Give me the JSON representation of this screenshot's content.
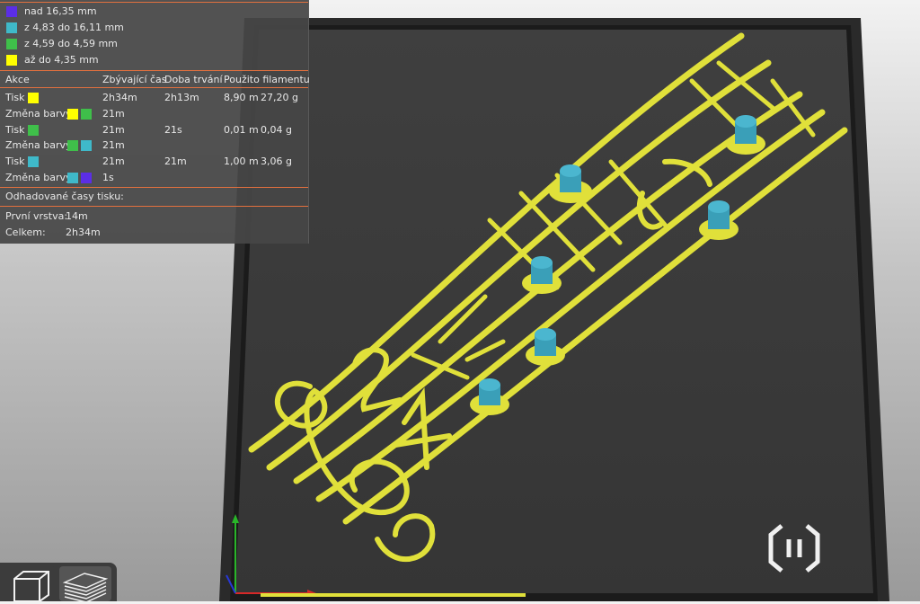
{
  "legend": {
    "ranges": [
      {
        "label": "nad 16,35 mm",
        "color": "#5b2ee6"
      },
      {
        "label": "z 4,83 do 16,11 mm",
        "color": "#3fb9c9"
      },
      {
        "label": "z 4,59 do 4,59 mm",
        "color": "#3fbf4a"
      },
      {
        "label": "až do 4,35 mm",
        "color": "#ffff00"
      }
    ]
  },
  "table": {
    "headers": {
      "action": "Akce",
      "remaining": "Zbývající čas",
      "duration": "Doba trvání",
      "used": "Použito filamentu"
    },
    "rows": [
      {
        "action": "Tisk",
        "colors": [
          "#ffff00"
        ],
        "remaining": "2h34m",
        "duration": "2h13m",
        "length": "8,90 m",
        "weight": "27,20 g"
      },
      {
        "action": "Změna barvy",
        "colors": [
          "#ffff00",
          "#3fbf4a"
        ],
        "remaining": "21m",
        "duration": "",
        "length": "",
        "weight": ""
      },
      {
        "action": "Tisk",
        "colors": [
          "#3fbf4a"
        ],
        "remaining": "21m",
        "duration": "21s",
        "length": "0,01 m",
        "weight": "0,04 g"
      },
      {
        "action": "Změna barvy",
        "colors": [
          "#3fbf4a",
          "#3fb9c9"
        ],
        "remaining": "21m",
        "duration": "",
        "length": "",
        "weight": ""
      },
      {
        "action": "Tisk",
        "colors": [
          "#3fb9c9"
        ],
        "remaining": "21m",
        "duration": "21m",
        "length": "1,00 m",
        "weight": "3,06 g"
      },
      {
        "action": "Změna barvy",
        "colors": [
          "#3fb9c9",
          "#5b2ee6"
        ],
        "remaining": "1s",
        "duration": "",
        "length": "",
        "weight": ""
      }
    ]
  },
  "estimates": {
    "title": "Odhadované časy tisku:",
    "first_layer_label": "První vrstva:",
    "first_layer_value": "14m",
    "total_label": "Celkem:",
    "total_value": "2h34m"
  },
  "model_colors": {
    "body": "#e2e23a",
    "body_dark": "#8a8a1a",
    "caps": "#3a9fb8",
    "bed": "#3a3a3a",
    "bed_frame": "#1e1e1e"
  },
  "view_buttons": {
    "iso_view": "cube-view-icon",
    "layers_view": "layers-view-icon"
  }
}
